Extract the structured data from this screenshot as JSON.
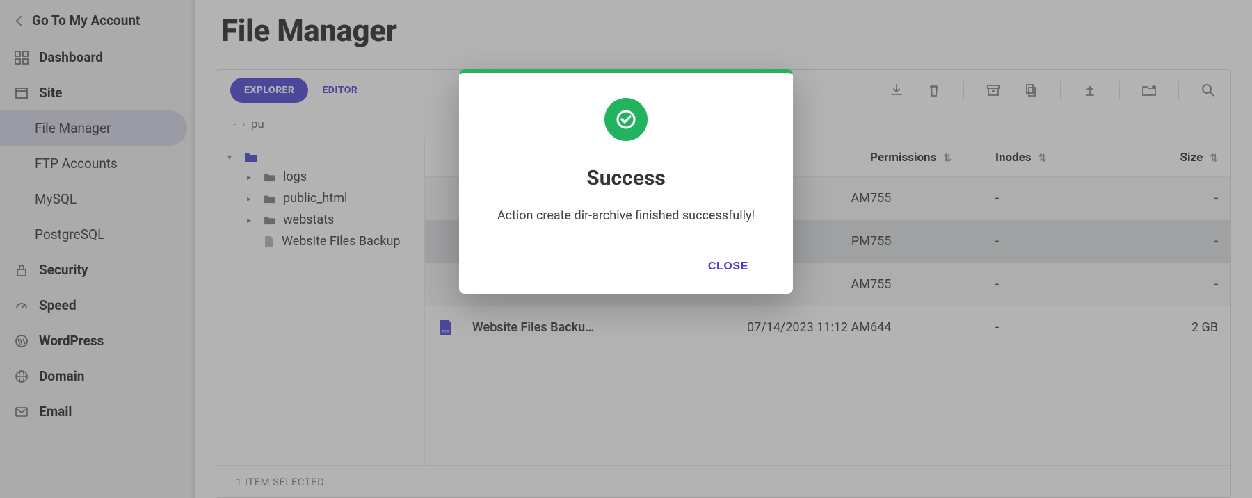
{
  "go_back_label": "Go To My Account",
  "nav": {
    "dashboard": "Dashboard",
    "site": "Site",
    "site_children": {
      "file_manager": "File Manager",
      "ftp": "FTP Accounts",
      "mysql": "MySQL",
      "postgres": "PostgreSQL"
    },
    "security": "Security",
    "speed": "Speed",
    "wordpress": "WordPress",
    "domain": "Domain",
    "email": "Email"
  },
  "page_title": "File Manager",
  "tabs": {
    "explorer": "EXPLORER",
    "editor": "EDITOR"
  },
  "breadcrumb": {
    "root": "-",
    "segment": "pu"
  },
  "tree": {
    "logs": "logs",
    "public_html": "public_html",
    "webstats": "webstats",
    "backup_zip": "Website Files Backup"
  },
  "columns": {
    "permissions": "Permissions",
    "inodes": "Inodes",
    "size": "Size"
  },
  "rows": [
    {
      "name": "",
      "date": "AM",
      "perm": "755",
      "inodes": "-",
      "size": "-",
      "icon": "folder"
    },
    {
      "name": "",
      "date": "PM",
      "perm": "755",
      "inodes": "-",
      "size": "-",
      "icon": "folder",
      "selected": true
    },
    {
      "name": "",
      "date": "AM",
      "perm": "755",
      "inodes": "-",
      "size": "-",
      "icon": "folder"
    },
    {
      "name": "Website Files Backu…",
      "date": "07/14/2023 11:12 AM",
      "perm": "644",
      "inodes": "-",
      "size": "2 GB",
      "icon": "zip"
    }
  ],
  "footer": "1 ITEM SELECTED",
  "modal": {
    "title": "Success",
    "body": "Action create dir-archive finished successfully!",
    "close": "CLOSE"
  }
}
